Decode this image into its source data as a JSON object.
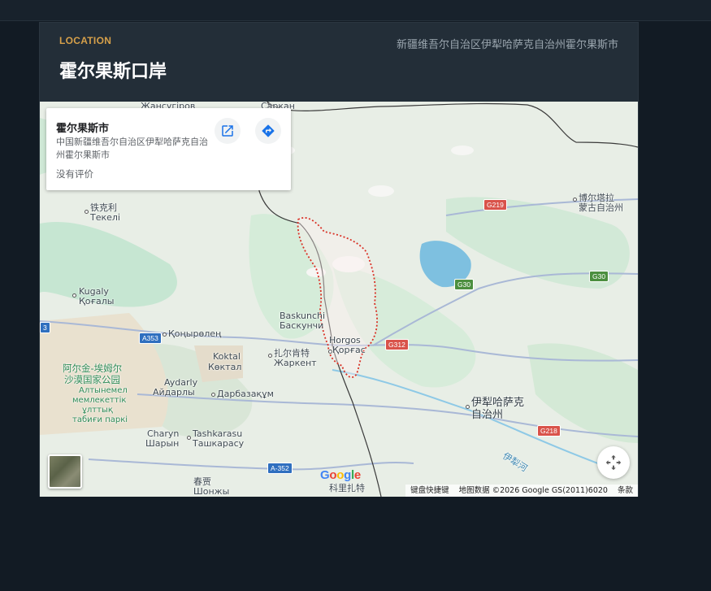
{
  "header": {
    "eyebrow": "LOCATION",
    "title": "霍尔果斯口岸",
    "address": "新疆维吾尔自治区伊犁哈萨克自治州霍尔果斯市"
  },
  "info_card": {
    "title": "霍尔果斯市",
    "address": "中国新疆维吾尔自治区伊犁哈萨克自治州霍尔果斯市",
    "rating": "没有评价",
    "open_icon": "open-in-new-icon",
    "directions_icon": "directions-icon"
  },
  "map_labels": {
    "sary": "Сарқан",
    "zhansugurov": "Жансугіров",
    "tekeli_cn": "铁克利",
    "tekeli": "Текелі",
    "bortala_cn": "博尔塔拉",
    "bortala_cn2": "蒙古自治州",
    "kugaly": "Kugaly",
    "kugaly_kz": "Қоғалы",
    "konyrolen": "Қоңырөлең",
    "baskunchi": "Baskunchi",
    "baskunchi_ru": "Баскунчи",
    "horgos": "Horgos",
    "horgos_kz": "Қорғас",
    "park_cn1": "阿尔金-埃姆尔",
    "park_cn2": "沙漠国家公园",
    "park_kz1": "Алтынемел",
    "park_kz2": "мемлекеттік",
    "park_kz3": "ұлттық",
    "park_kz4": "табиғи паркі",
    "koktal": "Koktal",
    "koktal_kz": "Көктал",
    "zharkent_cn": "扎尔肯特",
    "zharkent": "Жаркент",
    "aydarly": "Aydarly",
    "aydarly_kz": "Айдарлы",
    "darbaza": "Дарбазақұм",
    "ili_cn1": "伊犁哈萨克",
    "ili_cn2": "自治州",
    "charyn": "Charyn",
    "charyn_kz": "Шарын",
    "tashkarasu": "Tashkarasu",
    "tashkarasu_kz": "Ташкарасу",
    "chunjia": "春贾",
    "shonzhy": "Шонжы",
    "korgas_cn": "科里扎特",
    "ili_river": "伊犁河",
    "yili": "伊"
  },
  "shields": {
    "g219": "G219",
    "g30a": "G30",
    "g30b": "G30",
    "g312": "G312",
    "g218": "G218",
    "a353": "A353",
    "a352": "A-352",
    "a3": "3"
  },
  "attribution": {
    "shortcuts": "键盘快捷键",
    "data": "地图数据 ©2026 Google GS(2011)6020",
    "terms": "条款"
  },
  "google_logo": "Google",
  "colors": {
    "accent": "#d6a04a",
    "background": "#121b24",
    "card": "#1c2731",
    "boundary": "#d93025"
  }
}
